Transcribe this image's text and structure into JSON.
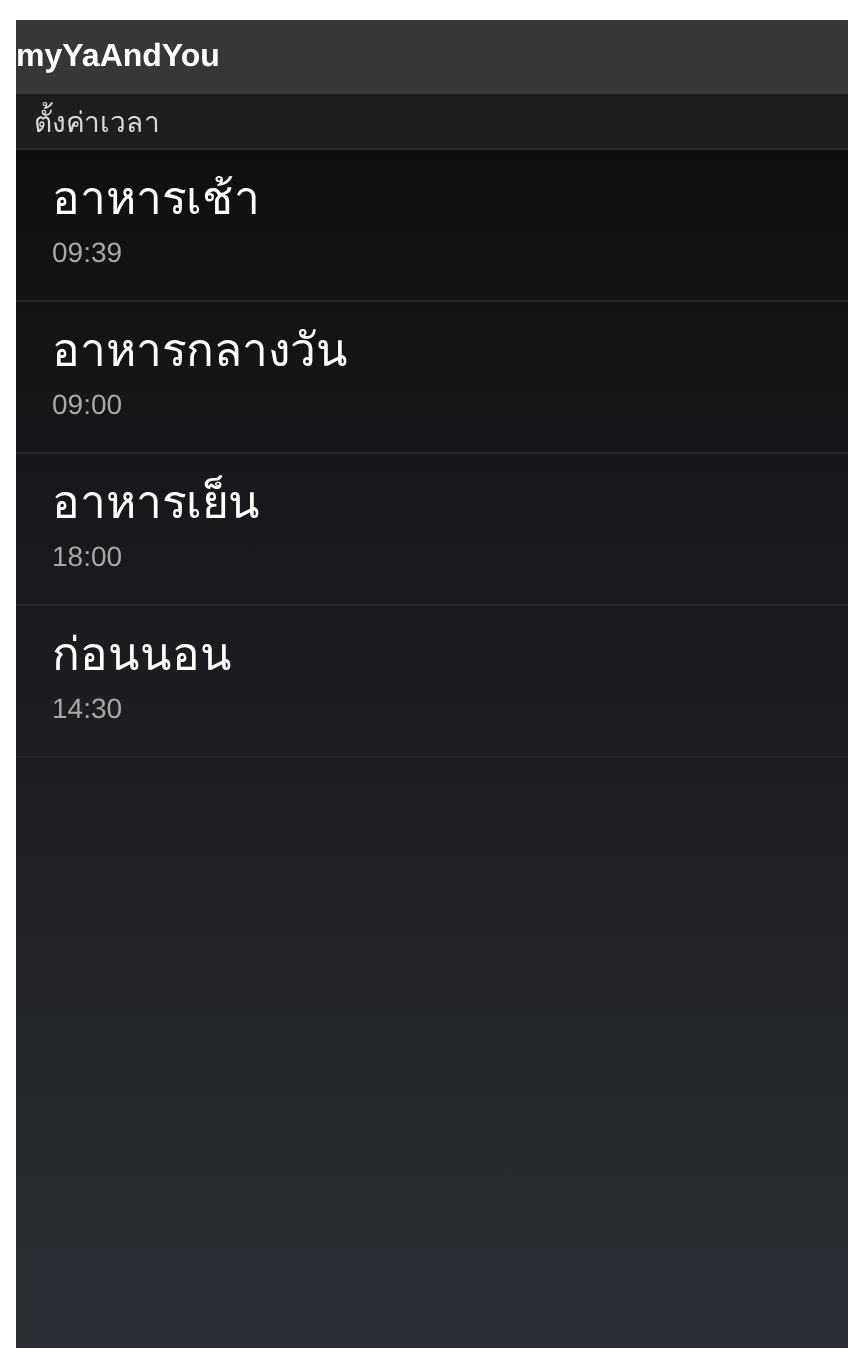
{
  "window": {
    "title": "myYaAndYou"
  },
  "section": {
    "title": "ตั้งค่าเวลา"
  },
  "items": [
    {
      "title": "อาหารเช้า",
      "time": "09:39"
    },
    {
      "title": "อาหารกลางวัน",
      "time": "09:00"
    },
    {
      "title": "อาหารเย็น",
      "time": "18:00"
    },
    {
      "title": "ก่อนนอน",
      "time": "14:30"
    }
  ]
}
